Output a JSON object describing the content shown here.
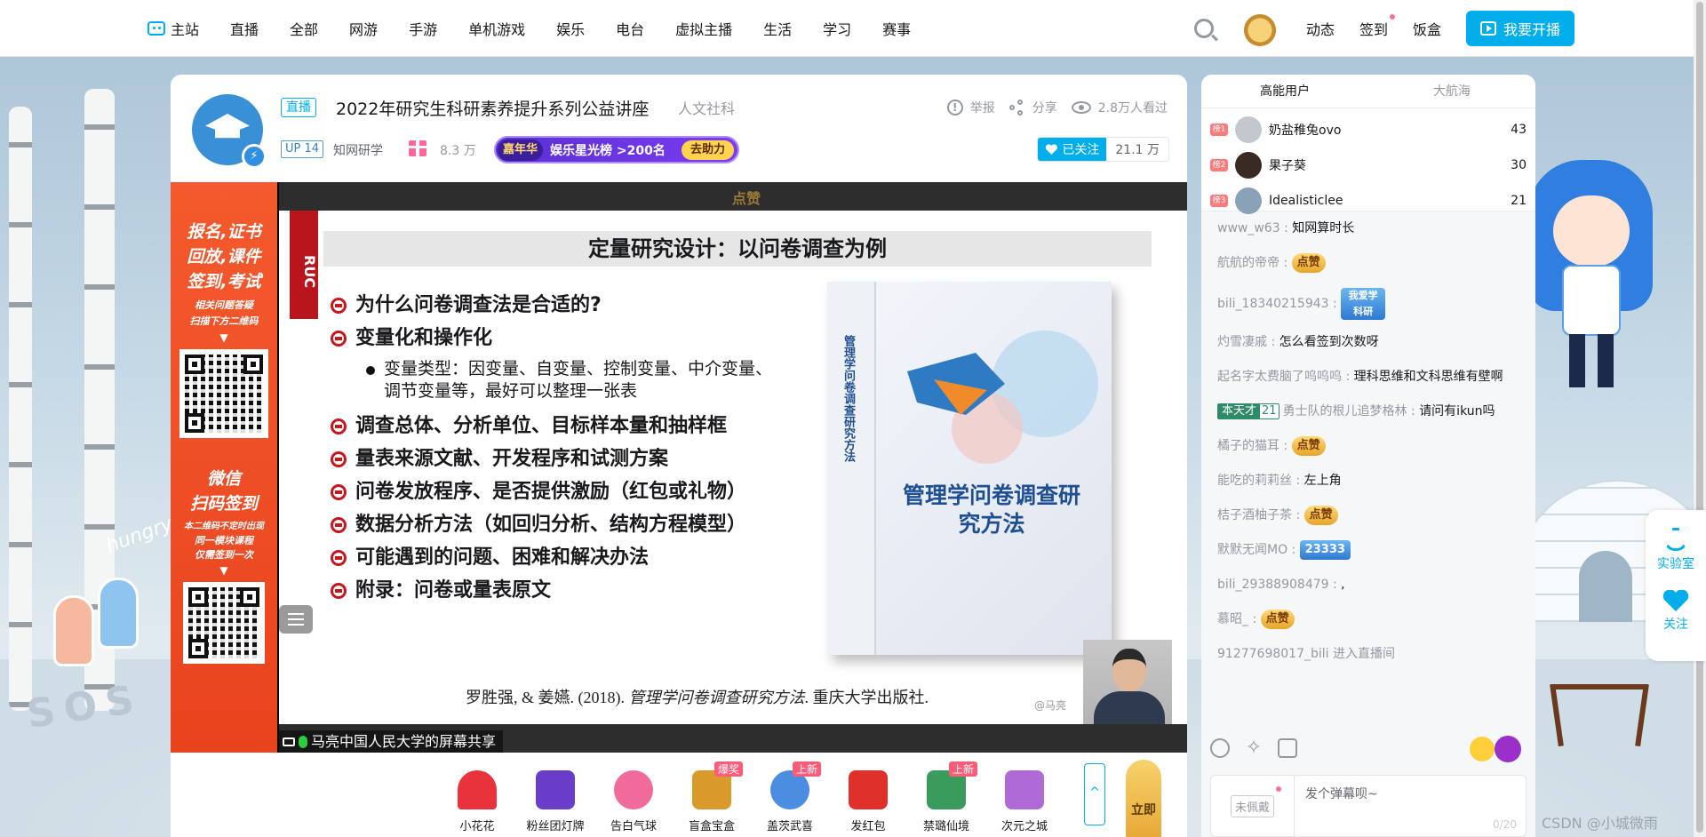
{
  "nav": {
    "home": "主站",
    "items": [
      "直播",
      "全部",
      "网游",
      "手游",
      "单机游戏",
      "娱乐",
      "电台",
      "虚拟主播",
      "生活",
      "学习",
      "赛事"
    ],
    "right_items": [
      "动态",
      "签到",
      "饭盒"
    ],
    "live_button": "我要开播"
  },
  "room": {
    "live_tag": "直播",
    "title": "2022年研究生科研素养提升系列公益讲座",
    "area": "人文社科",
    "report": "举报",
    "share": "分享",
    "viewers": "2.8万人看过",
    "up_level": "UP 14",
    "anchor_name": "知网研学",
    "gift_count": "8.3 万",
    "rank_tag": "嘉年华",
    "rank_text": "娱乐星光榜 >200名",
    "rank_go": "去助力",
    "follow_label": "已关注",
    "follow_count": "21.1 万"
  },
  "side_ad": {
    "line1": "报名,证书",
    "line2": "回放,课件",
    "line3": "签到,考试",
    "small1": "相关问题答疑",
    "small2": "扫描下方二维码",
    "wx1": "微信",
    "wx2": "扫码签到",
    "note1": "本二维码不定时出现",
    "note2": "同一模块课程",
    "note3": "仅需签到一次"
  },
  "slide": {
    "top_logo": "点赞",
    "ruc": "RUC",
    "title": "定量研究设计：以问卷调查为例",
    "bullets": [
      "为什么问卷调查法是合适的?",
      "变量化和操作化",
      "调查总体、分析单位、目标样本量和抽样框",
      "量表来源文献、开发程序和试测方案",
      "问卷发放程序、是否提供激励（红包或礼物）",
      "数据分析方法（如回归分析、结构方程模型）",
      "可能遇到的问题、困难和解决办法",
      "附录：问卷或量表原文"
    ],
    "sub_bullet_1": "变量类型：因变量、自变量、控制变量、中介变量、",
    "sub_bullet_2": "调节变量等，最好可以整理一张表",
    "book_spine": "管理学问卷调查研究方法",
    "book_title": "管理学问卷调查研究方法",
    "citation_authors": "罗胜强, & 姜嬿. (2018). ",
    "citation_title": "管理学问卷调查研究方法",
    "citation_pub": ". 重庆大学出版社.",
    "watermark": "@马亮",
    "share_label": "马亮中国人民大学的屏幕共享"
  },
  "gifts": [
    {
      "name": "小花花",
      "badge": "",
      "color": "#e8323c"
    },
    {
      "name": "粉丝团灯牌",
      "badge": "",
      "color": "#6a3dc9"
    },
    {
      "name": "告白气球",
      "badge": "",
      "color": "#f06a9c"
    },
    {
      "name": "盲盒宝盒",
      "badge": "爆奖",
      "color": "#d99a2b"
    },
    {
      "name": "盖茨武喜",
      "badge": "上新",
      "color": "#4b8de0"
    },
    {
      "name": "发红包",
      "badge": "",
      "color": "#e0302a"
    },
    {
      "name": "禁璐仙境",
      "badge": "上新",
      "color": "#3a9c5c"
    },
    {
      "name": "次元之城",
      "badge": "",
      "color": "#b06ad8"
    }
  ],
  "gift_more": "^",
  "gift_special": "立即",
  "chat": {
    "tab_active": "高能用户",
    "tab_other": "大航海",
    "ranks": [
      {
        "badge": "榜1",
        "name": "奶盐稚兔ovo",
        "score": "43",
        "color": "#c3c8ce"
      },
      {
        "badge": "榜2",
        "name": "果子葵",
        "score": "30",
        "color": "#3a2a24"
      },
      {
        "badge": "榜3",
        "name": "Idealisticlee",
        "score": "21",
        "color": "#8aa2b8"
      }
    ],
    "messages": [
      {
        "user": "www_w63 : ",
        "text": "知网算时长"
      },
      {
        "user": "航航的帝帝 : ",
        "emote": "点赞"
      },
      {
        "user": "bili_18340215943 : ",
        "emote_big": "我爱学科研"
      },
      {
        "user": "灼雪凄戚 : ",
        "text": "怎么看签到次数呀"
      },
      {
        "user": "起名字太费脑了呜呜呜 : ",
        "text": "理科思维和文科思维有壁啊"
      },
      {
        "medal_name": "本天才",
        "medal_level": "21",
        "user": "勇士队的根儿追梦格林 : ",
        "text": "请问有ikun吗"
      },
      {
        "user": "橘子的猫耳 : ",
        "emote": "点赞"
      },
      {
        "user": "能吃的莉莉丝 : ",
        "text": "左上角"
      },
      {
        "user": "桔子酒柚子茶 : ",
        "emote": "点赞"
      },
      {
        "user": "默默无闻MO : ",
        "emote_blue": "23333"
      },
      {
        "user": "bili_29388908479 : ",
        "text": ","
      },
      {
        "user": "慕昭_ : ",
        "emote": "点赞"
      },
      {
        "user": "",
        "text": "91277698017_bili 进入直播间"
      }
    ],
    "medal_slot": "未佩戴",
    "input_placeholder": "发个弹幕呗~",
    "input_count": "0/20"
  },
  "float": {
    "lab": "实验室",
    "follow": "关注"
  },
  "decor": {
    "sos": "SOS",
    "hungry": "hungry"
  },
  "watermark": "CSDN @小城微雨"
}
